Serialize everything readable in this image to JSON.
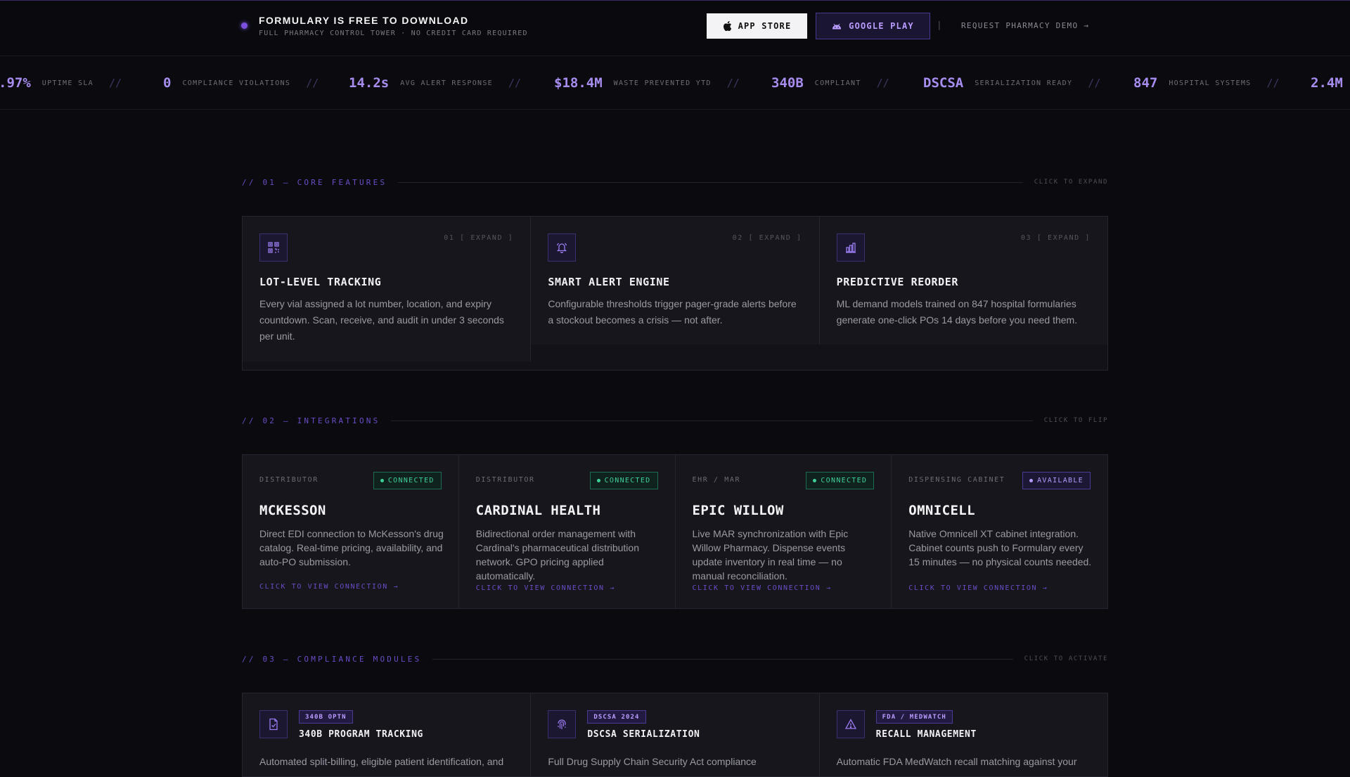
{
  "banner": {
    "title": "FORMULARY IS FREE TO DOWNLOAD",
    "subtitle": "FULL PHARMACY CONTROL TOWER · NO CREDIT CARD REQUIRED",
    "app_store_label": "APP STORE",
    "google_play_label": "GOOGLE PLAY",
    "separator": "|",
    "demo_link": "REQUEST PHARMACY DEMO →"
  },
  "ticker": {
    "separator": "//",
    "items": [
      {
        "value": ".97%",
        "label": "UPTIME SLA"
      },
      {
        "value": "0",
        "label": "COMPLIANCE VIOLATIONS"
      },
      {
        "value": "14.2s",
        "label": "AVG ALERT RESPONSE"
      },
      {
        "value": "$18.4M",
        "label": "WASTE PREVENTED YTD"
      },
      {
        "value": "340B",
        "label": "COMPLIANT"
      },
      {
        "value": "DSCSA",
        "label": "SERIALIZATION READY"
      },
      {
        "value": "847",
        "label": "HOSPITAL SYSTEMS"
      },
      {
        "value": "2.4M",
        "label": ""
      }
    ]
  },
  "features": {
    "section_title": "// 01 — CORE FEATURES",
    "hint": "CLICK TO EXPAND",
    "cards": [
      {
        "num": "01 [ EXPAND ]",
        "icon": "qr-scan-icon",
        "title": "LOT-LEVEL TRACKING",
        "desc": "Every vial assigned a lot number, location, and expiry countdown. Scan, receive, and audit in under 3 seconds per unit."
      },
      {
        "num": "02 [ EXPAND ]",
        "icon": "bell-icon",
        "title": "SMART ALERT ENGINE",
        "desc": "Configurable thresholds trigger pager-grade alerts before a stockout becomes a crisis — not after."
      },
      {
        "num": "03 [ EXPAND ]",
        "icon": "bar-chart-icon",
        "title": "PREDICTIVE REORDER",
        "desc": "ML demand models trained on 847 hospital formularies generate one-click POs 14 days before you need them."
      }
    ]
  },
  "integrations": {
    "section_title": "// 02 — INTEGRATIONS",
    "hint": "CLICK TO FLIP",
    "link_label": "CLICK TO VIEW CONNECTION →",
    "cards": [
      {
        "category": "DISTRIBUTOR",
        "status": "CONNECTED",
        "title": "MCKESSON",
        "desc": "Direct EDI connection to McKesson's drug catalog. Real-time pricing, availability, and auto-PO submission."
      },
      {
        "category": "DISTRIBUTOR",
        "status": "CONNECTED",
        "title": "CARDINAL HEALTH",
        "desc": "Bidirectional order management with Cardinal's pharmaceutical distribution network. GPO pricing applied automatically."
      },
      {
        "category": "EHR / MAR",
        "status": "CONNECTED",
        "title": "EPIC WILLOW",
        "desc": "Live MAR synchronization with Epic Willow Pharmacy. Dispense events update inventory in real time — no manual reconciliation."
      },
      {
        "category": "DISPENSING CABINET",
        "status": "AVAILABLE",
        "title": "OMNICELL",
        "desc": "Native Omnicell XT cabinet integration. Cabinet counts push to Formulary every 15 minutes — no physical counts needed."
      }
    ]
  },
  "compliance": {
    "section_title": "// 03 — COMPLIANCE MODULES",
    "hint": "CLICK TO ACTIVATE",
    "cards": [
      {
        "tag": "340B OPTN",
        "icon": "document-check-icon",
        "title": "340B PROGRAM TRACKING",
        "desc": "Automated split-billing, eligible patient identification, and"
      },
      {
        "tag": "DSCSA 2024",
        "icon": "fingerprint-icon",
        "title": "DSCSA SERIALIZATION",
        "desc": "Full Drug Supply Chain Security Act compliance"
      },
      {
        "tag": "FDA / MEDWATCH",
        "icon": "warning-triangle-icon",
        "title": "RECALL MANAGEMENT",
        "desc": "Automatic FDA MedWatch recall matching against your"
      }
    ]
  },
  "colors": {
    "background": "#0b0b0f",
    "accent": "#7b4fe0",
    "accent_text": "#a88df0",
    "connected": "#3fcf98",
    "card": "#17161c"
  }
}
